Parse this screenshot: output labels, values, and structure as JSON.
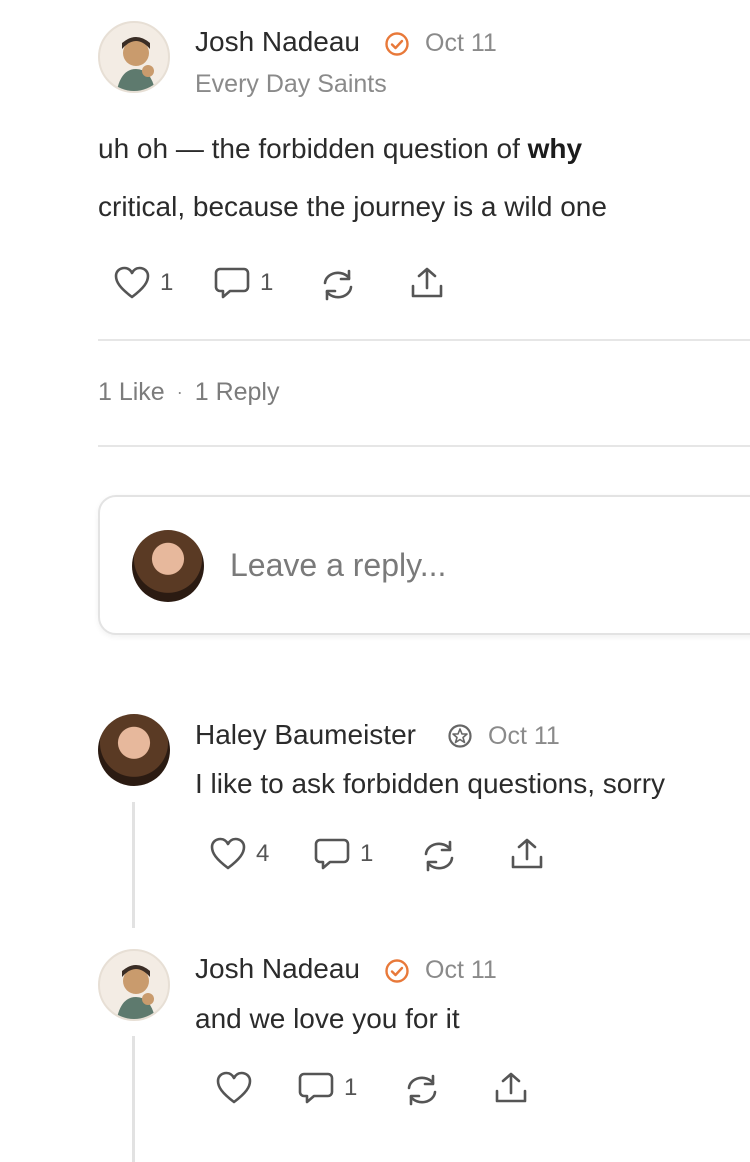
{
  "comment1": {
    "author": "Josh Nadeau",
    "date": "Oct 11",
    "publication": "Every Day Saints",
    "text_before": "uh oh — the forbidden question of ",
    "text_bold": "why",
    "text_line2": "critical, because the journey is a wild one",
    "likes": "1",
    "replies": "1",
    "badge_color": "#e8793a"
  },
  "stats": {
    "likes_label": "1 Like",
    "separator": "·",
    "replies_label": "1 Reply"
  },
  "reply_box": {
    "placeholder": "Leave a reply..."
  },
  "reply1": {
    "author": "Haley Baumeister",
    "date": "Oct 11",
    "text": "I like to ask forbidden questions, sorry",
    "likes": "4",
    "replies": "1"
  },
  "reply2": {
    "author": "Josh Nadeau",
    "date": "Oct 11",
    "text": "and we love you for it",
    "likes": "",
    "replies": "1",
    "badge_color": "#e8793a"
  }
}
